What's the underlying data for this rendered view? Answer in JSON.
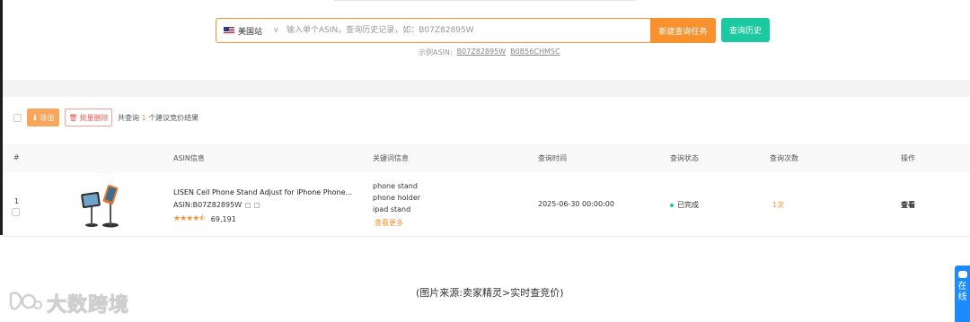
{
  "search": {
    "site_label": "美国站",
    "placeholder": "输入单个ASIN，查询历史记录，如：B07Z82895W",
    "new_task_label": "新建查询任务",
    "history_label": "查询历史",
    "examples_label": "示例ASIN:",
    "examples": [
      "B07Z82895W",
      "B0B56CHMSC"
    ]
  },
  "toolbar": {
    "export_label": "导出",
    "batch_delete_label": "批量删除",
    "summary_prefix": "共查询",
    "summary_count": "1",
    "summary_suffix": "个建议竞价结果"
  },
  "table": {
    "headers": [
      "#",
      "ASIN信息",
      "关键词信息",
      "查询时间",
      "查询状态",
      "查询次数",
      "操作"
    ],
    "rows": [
      {
        "index": "1",
        "title": "LISEN Cell Phone Stand Adjust for iPhone Phone...",
        "asin": "ASIN:B07Z82895W",
        "rating": 4.5,
        "reviews": "69,191",
        "keywords": [
          "phone stand",
          "phone holder",
          "ipad stand"
        ],
        "more_label": "查看更多",
        "time": "2025-06-30 00:00:00",
        "status": "已完成",
        "count": "1次",
        "action": "查看"
      }
    ]
  },
  "caption": "(图片来源:卖家精灵>实时查竞价)",
  "watermark": "大数跨境",
  "chat_widget": {
    "label": "在线"
  },
  "colors": {
    "accent": "#f7922f",
    "secondary": "#1cc9a0"
  }
}
